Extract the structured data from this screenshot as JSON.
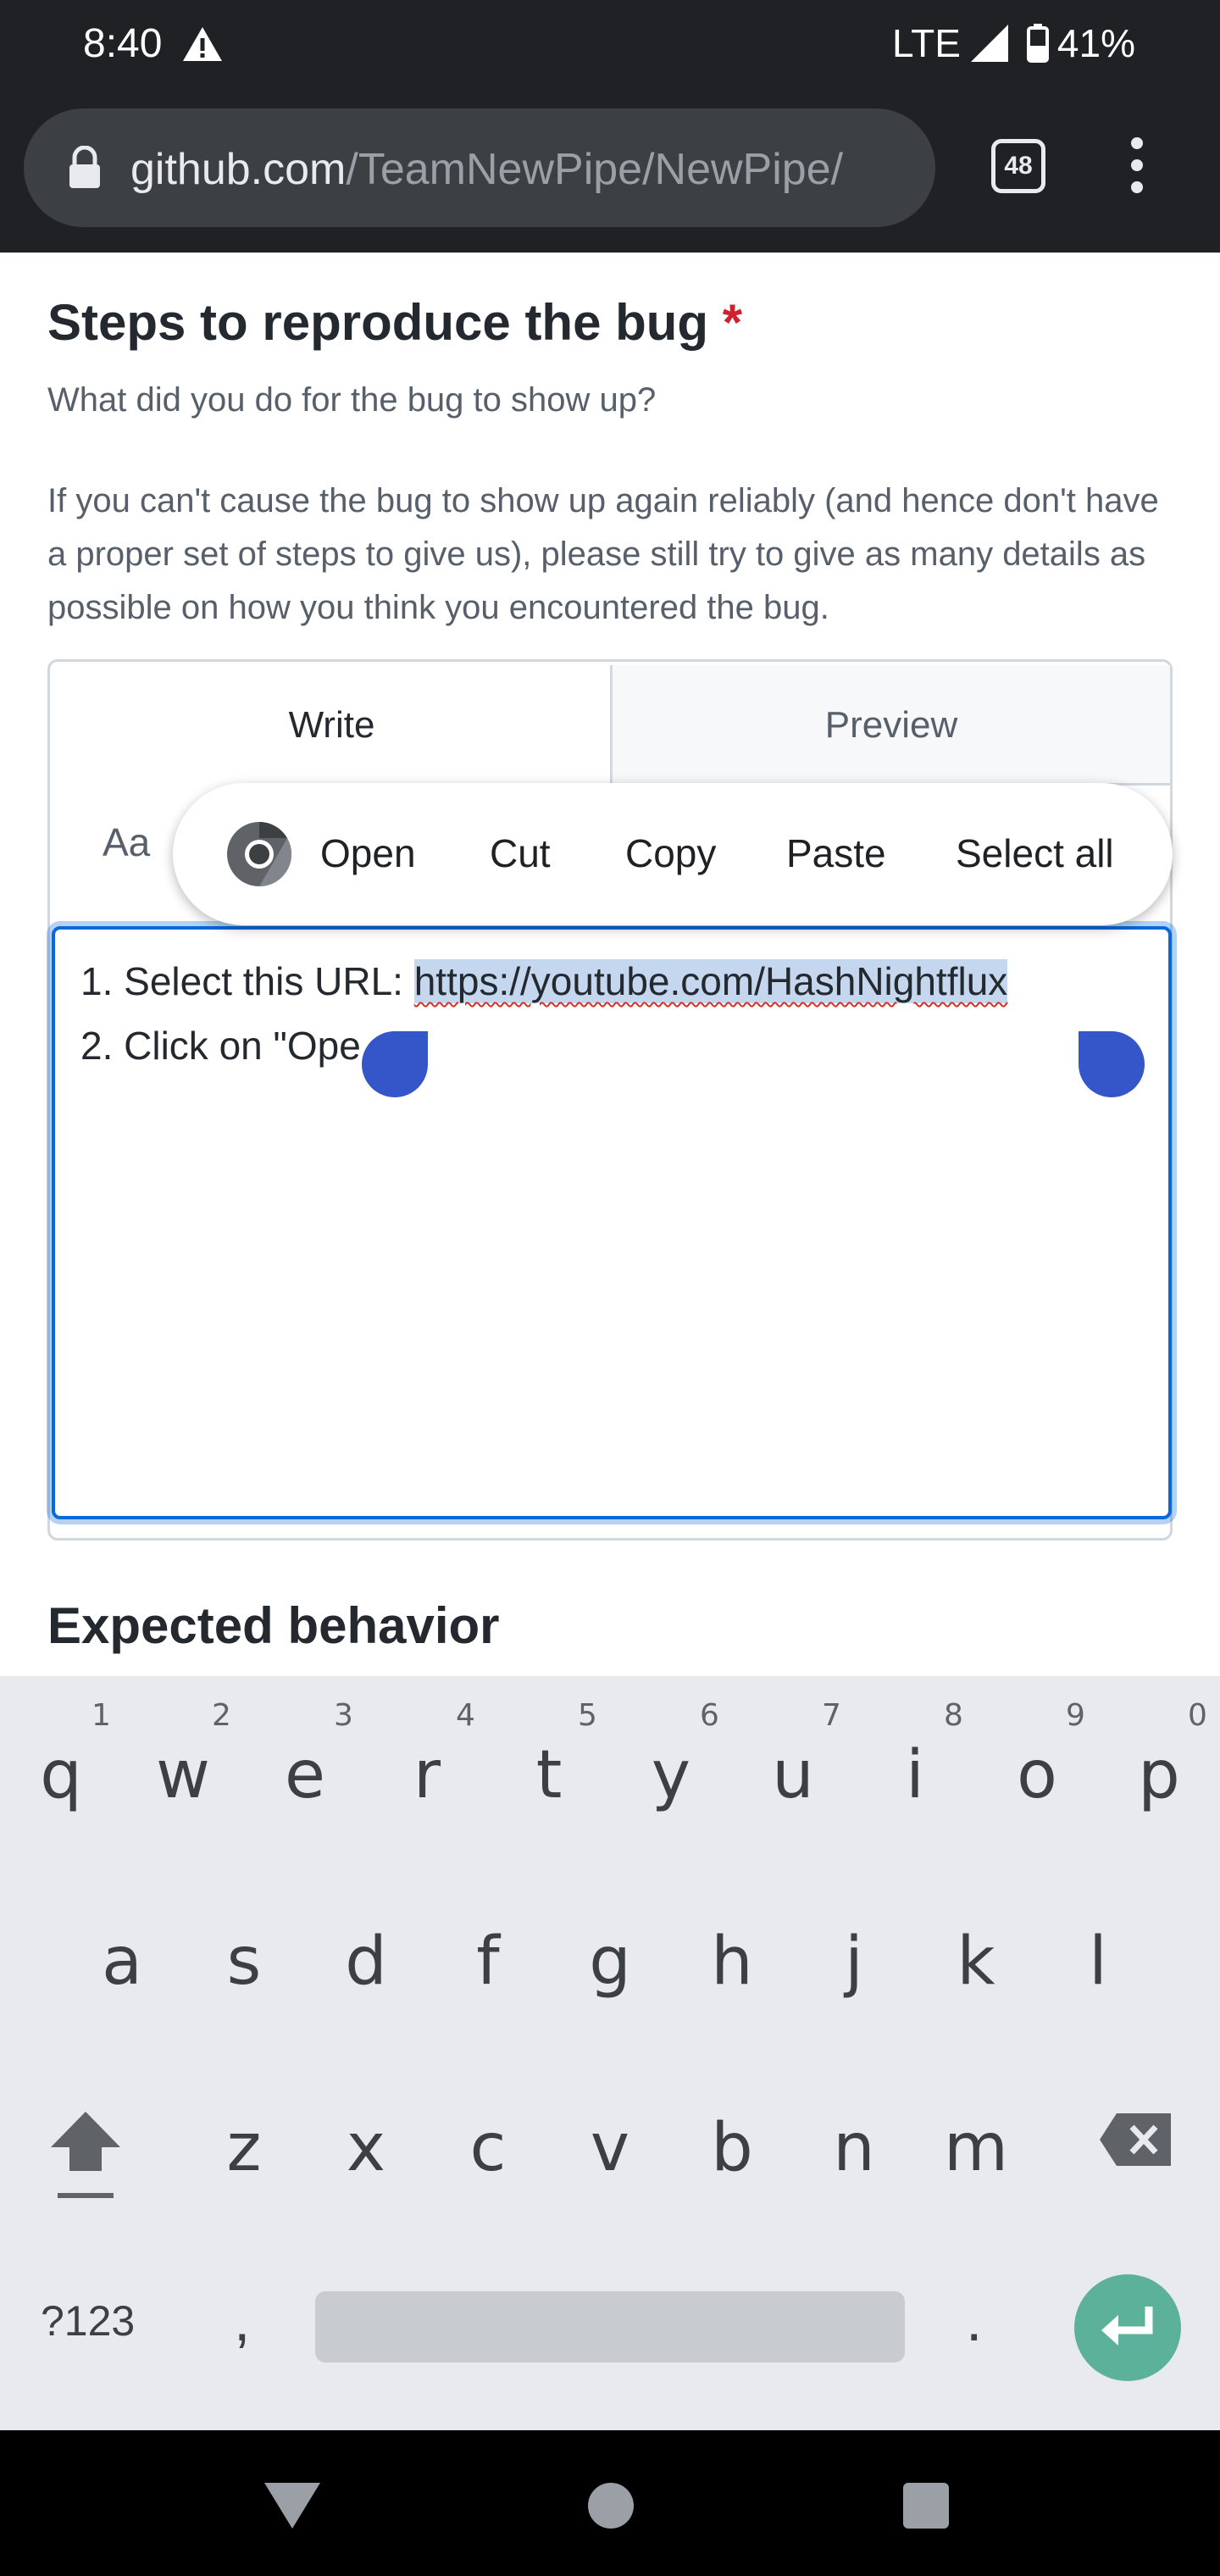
{
  "status_bar": {
    "time": "8:40",
    "network": "LTE",
    "battery": "41%"
  },
  "browser": {
    "url_domain": "github.com",
    "url_path": "/TeamNewPipe/NewPipe/",
    "tab_count": "48"
  },
  "form": {
    "section_title": "Steps to reproduce the bug",
    "required_marker": "*",
    "section_subtitle": "What did you do for the bug to show up?",
    "section_description": "If you can't cause the bug to show up again reliably (and hence don't have a proper set of steps to give us), please still try to give as many details as possible on how you think you encountered the bug.",
    "tab_write": "Write",
    "tab_preview": "Preview",
    "format_label": "Aa",
    "textarea": {
      "line1_prefix": "1. Select this URL: ",
      "line1_selected": "https://youtube.com/HashNightflux",
      "line2": "2. Click on \"Ope"
    },
    "next_section_title": "Expected behavior"
  },
  "context_menu": {
    "open": "Open",
    "cut": "Cut",
    "copy": "Copy",
    "paste": "Paste",
    "select_all": "Select all"
  },
  "keyboard": {
    "row1": [
      "q",
      "w",
      "e",
      "r",
      "t",
      "y",
      "u",
      "i",
      "o",
      "p"
    ],
    "row1_hints": [
      "1",
      "2",
      "3",
      "4",
      "5",
      "6",
      "7",
      "8",
      "9",
      "0"
    ],
    "row2": [
      "a",
      "s",
      "d",
      "f",
      "g",
      "h",
      "j",
      "k",
      "l"
    ],
    "row3": [
      "z",
      "x",
      "c",
      "v",
      "b",
      "n",
      "m"
    ],
    "symbols_key": "?123",
    "comma_key": ",",
    "period_key": "."
  },
  "colors": {
    "accent": "#0969da",
    "selection": "#c5d7ee",
    "handle": "#3556c9",
    "enter_key": "#5cb19a",
    "required": "#cf222e"
  }
}
